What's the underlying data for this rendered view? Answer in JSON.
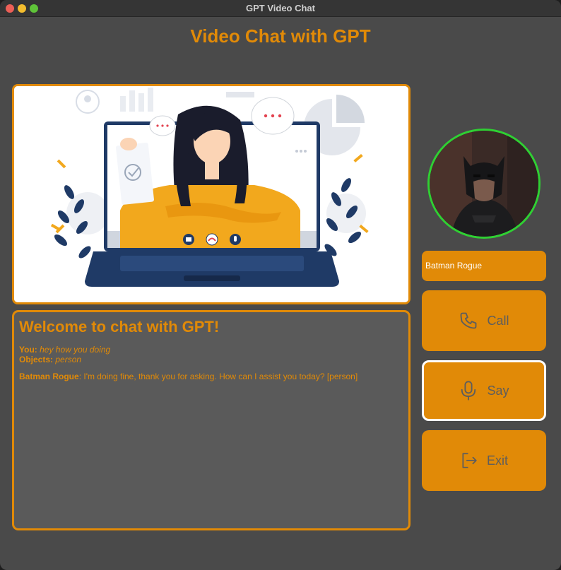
{
  "window": {
    "title": "GPT Video Chat"
  },
  "header": {
    "title": "Video Chat with GPT"
  },
  "chat": {
    "title": "Welcome to chat with GPT!",
    "messages": [
      {
        "label": "You:",
        "text": "hey how you doing"
      },
      {
        "label": "Objects:",
        "text": "person"
      },
      {
        "label": "Batman Rogue",
        "text": ": I'm doing fine, thank you for asking. How can I assist you today? [person]"
      }
    ]
  },
  "sidebar": {
    "contact_name": "Batman Rogue",
    "call_label": "Call",
    "say_label": "Say",
    "exit_label": "Exit"
  },
  "icons": {
    "call": "phone-icon",
    "say": "microphone-icon",
    "exit": "exit-icon"
  },
  "colors": {
    "accent": "#e18a07",
    "background": "#4a4a4a",
    "chat_bg": "#5a5a5a",
    "avatar_ring": "#2fd033",
    "button_text": "#5d5d5d"
  }
}
